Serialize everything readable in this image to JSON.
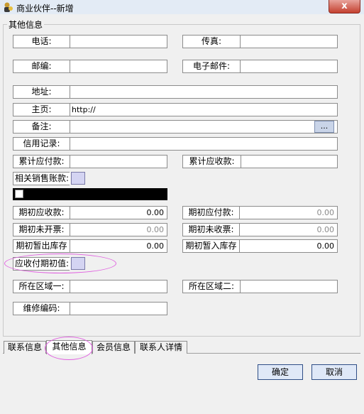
{
  "window": {
    "title": "商业伙伴--新增",
    "close_glyph": "x"
  },
  "group": {
    "legend": "其他信息"
  },
  "fields": {
    "phone": {
      "label": "电话:",
      "value": ""
    },
    "fax": {
      "label": "传真:",
      "value": ""
    },
    "zip": {
      "label": "邮编:",
      "value": ""
    },
    "email": {
      "label": "电子邮件:",
      "value": ""
    },
    "address": {
      "label": "地址:",
      "value": ""
    },
    "homepage": {
      "label": "主页:",
      "value": "http://"
    },
    "remark": {
      "label": "备注:",
      "value": "",
      "button": "..."
    },
    "credit": {
      "label": "信用记录:",
      "value": ""
    },
    "total_payable": {
      "label": "累计应付款:",
      "value": ""
    },
    "total_receivable": {
      "label": "累计应收款:",
      "value": ""
    },
    "related_sales_account": {
      "label": "相关销售账款:"
    },
    "opening_receivable": {
      "label": "期初应收款:",
      "value": "0.00"
    },
    "opening_payable": {
      "label": "期初应付款:",
      "value": "0.00"
    },
    "opening_uninvoiced": {
      "label": "期初未开票:",
      "value": "0.00"
    },
    "opening_unreceived_invoice": {
      "label": "期初未收票:",
      "value": "0.00"
    },
    "opening_temp_out_stock": {
      "label": "期初暂出库存",
      "value": "0.00"
    },
    "opening_temp_in_stock": {
      "label": "期初暂入库存",
      "value": "0.00"
    },
    "ar_ap_opening_value": {
      "label": "应收付期初值:"
    },
    "region_one": {
      "label": "所在区域一:",
      "value": ""
    },
    "region_two": {
      "label": "所在区域二:",
      "value": ""
    },
    "repair_code": {
      "label": "维修编码:",
      "value": ""
    }
  },
  "tabs": [
    {
      "label": "联系信息",
      "active": false
    },
    {
      "label": "其他信息",
      "active": true
    },
    {
      "label": "会员信息",
      "active": false
    },
    {
      "label": "联系人详情",
      "active": false
    }
  ],
  "buttons": {
    "ok": "确定",
    "cancel": "取消"
  },
  "colors": {
    "highlight": "#e060e0",
    "picker": "#d4d4f2",
    "button_border": "#2f4e86"
  }
}
